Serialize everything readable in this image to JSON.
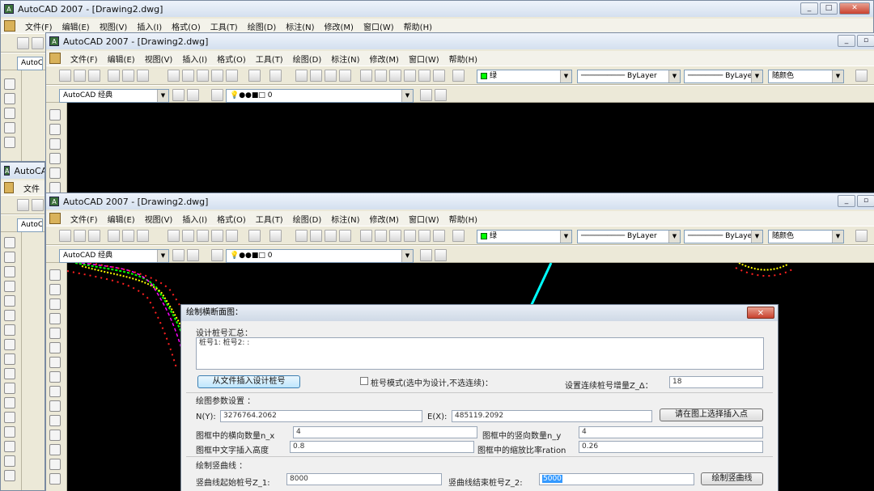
{
  "window": {
    "title": "AutoCAD 2007 - [Drawing2.dwg]",
    "title_partial": "AutoCA",
    "min_glyph": "_",
    "max_glyph": "□",
    "restore_glyph": "▫",
    "close_glyph": "✕"
  },
  "menu": [
    "文件(F)",
    "编辑(E)",
    "视图(V)",
    "插入(I)",
    "格式(O)",
    "工具(T)",
    "绘图(D)",
    "标注(N)",
    "修改(M)",
    "窗口(W)",
    "帮助(H)"
  ],
  "menu_partial": [
    "文件",
    "文件"
  ],
  "toolbar": {
    "workspace": "AutoCAD 经典",
    "workspace_partial": "AutoCA",
    "color": "绿",
    "linetype": "ByLayer",
    "lineweight": "ByLayer",
    "plotstyle": "随颜色",
    "layer": "0"
  },
  "dialog": {
    "title": "绘制横断面图：",
    "close_glyph": "✕",
    "design_group": "设计桩号汇总：",
    "design_text": "桩号1: 桩号2: :",
    "insert_from_file": "从文件插入设计桩号",
    "mode_checkbox": "桩号模式(选中为设计,不选连续)：",
    "increment_label": "设置连续桩号增量Z_Δ：",
    "increment_value": "18",
    "params_group": "绘图参数设置 ：",
    "n_label": "N(Y):",
    "n_value": "3276764.2062",
    "e_label": "E(X):",
    "e_value": "485119.2092",
    "pick_point": "请在图上选择插入点",
    "nx_label": "图框中的横向数量n_x",
    "nx_value": "4",
    "ny_label": "图框中的竖向数量n_y",
    "ny_value": "4",
    "text_height_label": "图框中文字插入高度",
    "text_height_value": "0.8",
    "ratio_label": "图框中的缩放比率ration",
    "ratio_value": "0.26",
    "curve_group": "绘制竖曲线 ：",
    "z1_label": "竖曲线起始桩号Z_1:",
    "z1_value": "8000",
    "z2_label": "竖曲线结束桩号Z_2:",
    "z2_value": "5000",
    "draw_curve": "绘制竖曲线"
  },
  "colors": {
    "canvas": "#000000",
    "chrome": "#ece9d8",
    "accent_yellow": "#ffff00",
    "accent_green": "#00ff00",
    "accent_red": "#ff2020",
    "accent_magenta": "#ff00ff",
    "accent_cyan": "#00ffff"
  }
}
